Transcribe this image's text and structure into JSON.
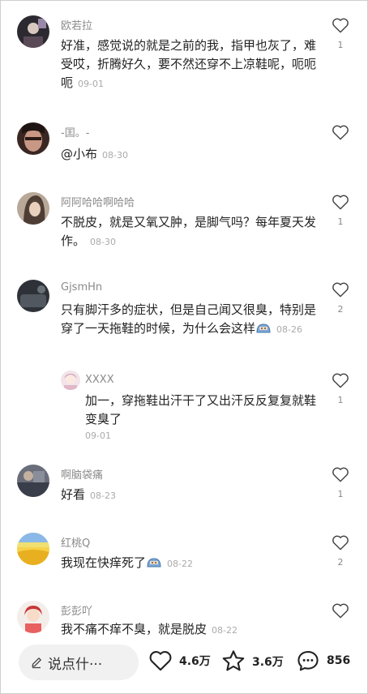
{
  "comments": [
    {
      "name": "欧若拉",
      "text": "好准，感觉说的就是之前的我，指甲也灰了，难受哎，折腾好久，要不然还穿不上凉鞋呢，呃呃呃",
      "date": "09-01",
      "likes": "1",
      "avatar_color": "#3a3036"
    },
    {
      "name": "-囯。-",
      "text": "@小布",
      "date": "08-30",
      "likes": "",
      "avatar_color": "#5a3a30"
    },
    {
      "name": "阿阿哈哈啊哈哈",
      "text": "不脱皮，就是又氧又肿，是脚气吗？每年夏天发作。",
      "date": "08-30",
      "likes": "1",
      "avatar_color": "#8a7060"
    },
    {
      "name": "GjsmHn",
      "text": "只有脚汗多的症状，但是自己闻又很臭，特别是穿了一天拖鞋的时候，为什么会这样",
      "date": "08-26",
      "likes": "2",
      "avatar_color": "#3b3f48",
      "reply": {
        "name": "XXXX",
        "text": "加一，穿拖鞋出汗干了又出汗反反复复就鞋变臭了",
        "date": "09-01",
        "likes": "1"
      }
    },
    {
      "name": "啊脑袋痛",
      "text": "好看",
      "date": "08-23",
      "likes": "1",
      "avatar_color": "#4a4e5a"
    },
    {
      "name": "红桃Q",
      "text": "我现在快痒死了",
      "date": "08-22",
      "likes": "2",
      "avatar_color": "#e0b020"
    },
    {
      "name": "彭彭吖",
      "text": "我不痛不痒不臭，就是脱皮",
      "date": "08-22",
      "likes": "",
      "avatar_color": "#d06060"
    }
  ],
  "bottom_bar": {
    "input_placeholder": "说点什···",
    "like_count": "4.6万",
    "fav_count": "3.6万",
    "comment_count": "856"
  }
}
